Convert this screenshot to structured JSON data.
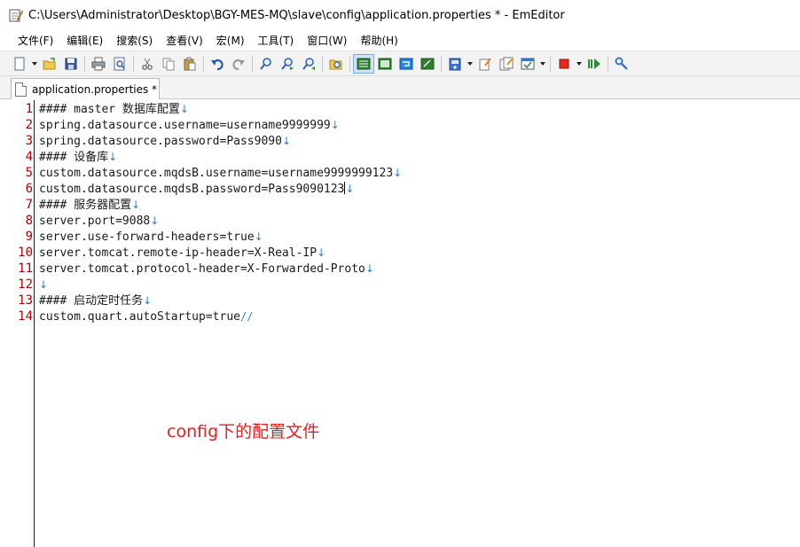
{
  "window": {
    "title": "C:\\Users\\Administrator\\Desktop\\BGY-MES-MQ\\slave\\config\\application.properties * - EmEditor"
  },
  "menu": [
    {
      "label": "文件(F)"
    },
    {
      "label": "编辑(E)"
    },
    {
      "label": "搜索(S)"
    },
    {
      "label": "查看(V)"
    },
    {
      "label": "宏(M)"
    },
    {
      "label": "工具(T)"
    },
    {
      "label": "窗口(W)"
    },
    {
      "label": "帮助(H)"
    }
  ],
  "toolbar_icons": [
    "new-file-icon",
    "open-folder-icon",
    "save-icon",
    "print-icon",
    "print-preview-icon",
    "cut-icon",
    "copy-icon",
    "paste-icon",
    "undo-icon",
    "redo-icon",
    "find-icon",
    "find-next-icon",
    "find-previous-icon",
    "find-in-files-icon",
    "word-wrap-icon",
    "wrap-window-icon",
    "wrap-page-icon",
    "wrap-fixed-icon",
    "configuration-icon",
    "customize-icon",
    "properties-icon",
    "marks-icon",
    "record-macro-icon",
    "run-macro-icon",
    "tools-icon"
  ],
  "tab": {
    "label": "application.properties *"
  },
  "editor": {
    "lines": [
      {
        "num": "1",
        "text": "#### master 数据库配置"
      },
      {
        "num": "2",
        "text": "spring.datasource.username=username9999999"
      },
      {
        "num": "3",
        "text": "spring.datasource.password=Pass9090"
      },
      {
        "num": "4",
        "text": "#### 设备库"
      },
      {
        "num": "5",
        "text": "custom.datasource.mqdsB.username=username9999999123"
      },
      {
        "num": "6",
        "text": "custom.datasource.mqdsB.password=Pass9090123"
      },
      {
        "num": "7",
        "text": "#### 服务器配置"
      },
      {
        "num": "8",
        "text": "server.port=9088"
      },
      {
        "num": "9",
        "text": "server.use-forward-headers=true"
      },
      {
        "num": "10",
        "text": "server.tomcat.remote-ip-header=X-Real-IP"
      },
      {
        "num": "11",
        "text": "server.tomcat.protocol-header=X-Forwarded-Proto"
      },
      {
        "num": "12",
        "text": ""
      },
      {
        "num": "13",
        "text": "#### 启动定时任务"
      },
      {
        "num": "14",
        "text": "custom.quart.autoStartup=true"
      }
    ],
    "eol_mark": "↓",
    "eof_mark": "//"
  },
  "annotation": {
    "text": "config下的配置文件"
  },
  "colors": {
    "line_number": "#b00000",
    "eol_mark": "#2a7fd0",
    "annotation": "#e0201b",
    "toolbar_bg": "#f3f3f3"
  }
}
